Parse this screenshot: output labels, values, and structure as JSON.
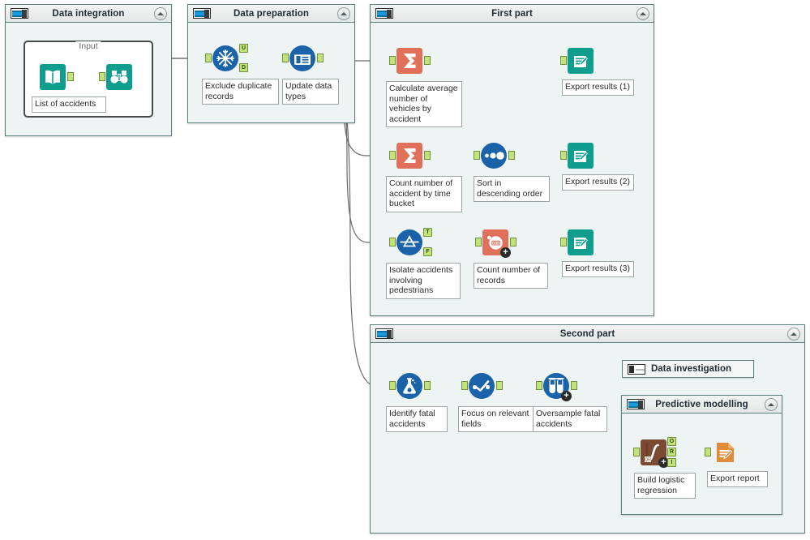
{
  "containers": [
    {
      "id": "data-integration",
      "title": "Data integration",
      "icon": "metanode-icon",
      "collapse_icon": "chevron-up-icon"
    },
    {
      "id": "data-preparation",
      "title": "Data preparation",
      "icon": "metanode-icon",
      "collapse_icon": "chevron-up-icon"
    },
    {
      "id": "first-part",
      "title": "First part",
      "icon": "metanode-icon",
      "collapse_icon": "chevron-up-icon"
    },
    {
      "id": "second-part",
      "title": "Second part",
      "icon": "metanode-icon",
      "collapse_icon": "chevron-up-icon"
    },
    {
      "id": "predictive-modelling",
      "title": "Predictive modelling",
      "icon": "metanode-icon",
      "collapse_icon": "chevron-up-icon"
    }
  ],
  "inner_frame": {
    "label": "Input"
  },
  "collapsed_nodes": [
    {
      "id": "data-investigation",
      "title": "Data investigation",
      "icon": "collapsed-metanode-icon"
    }
  ],
  "nodes": [
    {
      "id": "list-of-accidents",
      "label": "List of accidents",
      "icon": "open-book-icon",
      "shape": "square",
      "color": "#0f9e8e"
    },
    {
      "id": "binoculars",
      "label": "",
      "icon": "binoculars-icon",
      "shape": "square",
      "color": "#0f9e8e"
    },
    {
      "id": "exclude-duplicate-records",
      "label": "Exclude duplicate\nrecords",
      "icon": "snowflake-icon",
      "shape": "circle",
      "color": "#1a63a8",
      "out_ports": [
        "U",
        "D"
      ]
    },
    {
      "id": "update-data-types",
      "label": "Update data\ntypes",
      "icon": "table-columns-icon",
      "shape": "circle",
      "color": "#1a63a8"
    },
    {
      "id": "calculate-average-number-of-vehicles",
      "label": "Calculate average\nnumber of\nvehicles by\naccident",
      "icon": "sigma-icon",
      "shape": "square",
      "color": "#e0705a"
    },
    {
      "id": "export-results-1",
      "label": "Export results (1)",
      "icon": "export-folder-icon",
      "shape": "square",
      "color": "#0f9e8e"
    },
    {
      "id": "count-accident-by-time-bucket",
      "label": "Count number of\naccident by time\nbucket",
      "icon": "sigma-icon",
      "shape": "square",
      "color": "#e0705a"
    },
    {
      "id": "sort-descending",
      "label": "Sort in\ndescending order",
      "icon": "sort-circles-icon",
      "shape": "circle",
      "color": "#1a63a8"
    },
    {
      "id": "export-results-2",
      "label": "Export results (2)",
      "icon": "export-folder-icon",
      "shape": "square",
      "color": "#0f9e8e"
    },
    {
      "id": "isolate-accidents-pedestrians",
      "label": "Isolate accidents\ninvolving\npedestrians",
      "icon": "row-splitter-icon",
      "shape": "circle",
      "color": "#1a63a8",
      "out_ports": [
        "T",
        "F"
      ]
    },
    {
      "id": "count-number-of-records",
      "label": "Count number of\nrecords",
      "icon": "counter-icon",
      "shape": "square",
      "color": "#e0705a"
    },
    {
      "id": "export-results-3",
      "label": "Export results (3)",
      "icon": "export-folder-icon",
      "shape": "square",
      "color": "#0f9e8e"
    },
    {
      "id": "identify-fatal-accidents",
      "label": "Identify fatal\naccidents",
      "icon": "flask-icon",
      "shape": "circle",
      "color": "#1a63a8"
    },
    {
      "id": "focus-on-relevant-fields",
      "label": "Focus on relevant\nfields",
      "icon": "column-filter-icon",
      "shape": "circle",
      "color": "#1a63a8"
    },
    {
      "id": "oversample-fatal-accidents",
      "label": "Oversample fatal\naccidents",
      "icon": "test-tubes-icon",
      "shape": "circle",
      "color": "#1a63a8"
    },
    {
      "id": "build-logistic-regression",
      "label": "Build logistic\nregression",
      "icon": "logistic-curve-icon",
      "shape": "square",
      "color": "#7b4a32",
      "out_ports": [
        "O",
        "R",
        "I"
      ]
    },
    {
      "id": "export-report",
      "label": "Export report",
      "icon": "report-document-icon",
      "shape": "square",
      "color": "#e08a3c"
    }
  ],
  "colors": {
    "canvas_background": "#ffffff",
    "container_background": "#eef3f3",
    "container_border": "#5f7f7e",
    "port_green": "#c3e37a",
    "edge": "#6b6b6b",
    "teal": "#0f9e8e",
    "blue": "#1a63a8",
    "salmon": "#e0705a",
    "brown": "#7b4a32",
    "orange": "#e08a3c"
  }
}
